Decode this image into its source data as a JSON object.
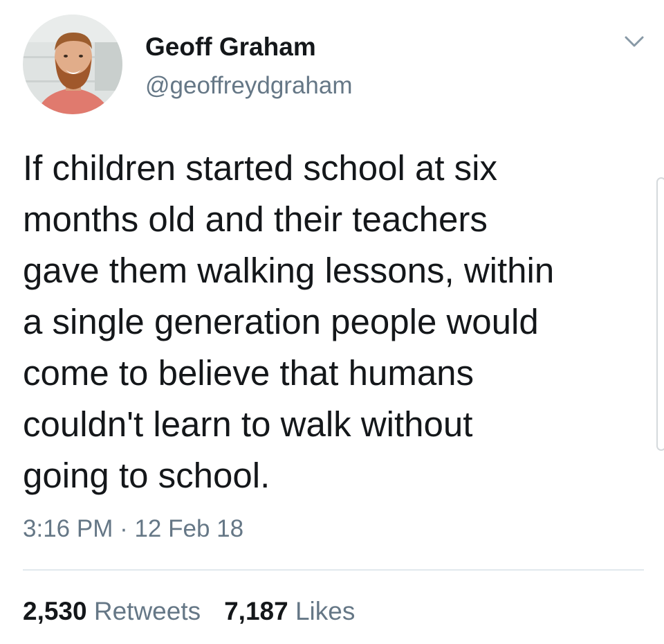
{
  "user": {
    "display_name": "Geoff Graham",
    "handle": "@geoffreydgraham"
  },
  "tweet": {
    "text": "If children started school at six\nmonths old and their teachers\ngave them walking lessons, within\na single generation people would\ncome to believe that humans\ncouldn't learn to walk without\ngoing to school.",
    "timestamp": "3:16 PM · 12 Feb 18"
  },
  "stats": {
    "retweets_count": "2,530",
    "retweets_label": "Retweets",
    "likes_count": "7,187",
    "likes_label": "Likes"
  },
  "icons": {
    "menu": "chevron-down-icon"
  },
  "colors": {
    "text_primary": "#14171a",
    "text_secondary": "#657786",
    "divider": "#e1e8ed"
  }
}
